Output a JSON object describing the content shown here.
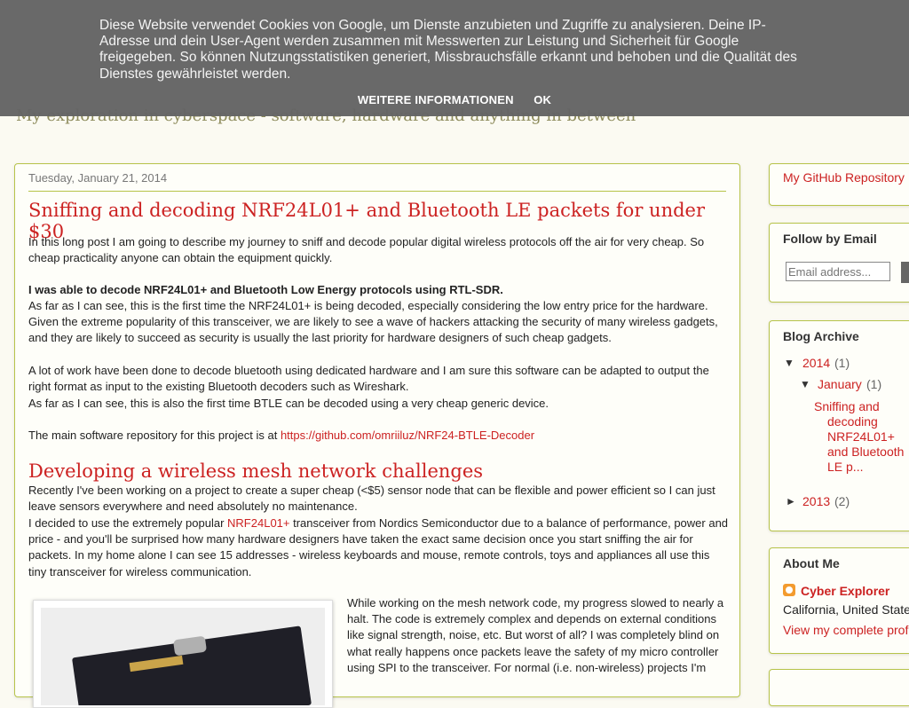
{
  "header": {
    "description": "My exploration in cyberspace - software, hardware and anything in between"
  },
  "cookie_bar": {
    "text": "Diese Website verwendet Cookies von Google, um Dienste anzubieten und Zugriffe zu analysieren. Deine IP-Adresse und dein User-Agent werden zusammen mit Messwerten zur Leistung und Sicherheit für Google freigegeben. So können Nutzungsstatistiken generiert, Missbrauchsfälle erkannt und behoben und die Qualität des Dienstes gewährleistet werden.",
    "more_info": "WEITERE INFORMATIONEN",
    "ok": "OK"
  },
  "post": {
    "date": "Tuesday, January 21, 2014",
    "title": "Sniffing and decoding NRF24L01+ and Bluetooth LE packets for under $30",
    "intro": "In this long post I am going to describe my journey to sniff and decode popular digital wireless protocols off the air for very cheap. So cheap practicality anyone can obtain the equipment quickly.",
    "bold_line": "I was able to decode NRF24L01+ and Bluetooth Low Energy protocols using RTL-SDR.",
    "para2": "As far as I can see, this is the first time the NRF24L01+ is being decoded, especially considering the low entry price for the hardware. Given the extreme popularity of this transceiver, we are likely to see a wave of hackers attacking the security of many wireless gadgets, and they are likely to succeed as security is usually the last priority for hardware designers of such cheap gadgets.",
    "para3": "A lot of work have been done to decode bluetooth using dedicated hardware and I am sure this software can be adapted to output the right format as input to the existing Bluetooth decoders such as Wireshark.",
    "para4": "As far as I can see, this is also the first time BTLE can be decoded using a very cheap generic device.",
    "repo_prefix": "The main software repository for this project is at ",
    "repo_link": "https://github.com/omriiluz/NRF24-BTLE-Decoder",
    "subheading": "Developing a wireless mesh network challenges",
    "para5": "Recently I've been working on a project to create a super cheap (<$5) sensor node that can be flexible and power efficient so I can just leave sensors everywhere and need absolutely no maintenance.",
    "para6_prefix": "I decided to use the extremely popular ",
    "para6_link": "NRF24L01+",
    "para6_suffix": " transceiver from Nordics Semiconductor due to a balance of performance, power and price - and you'll be surprised how many hardware designers have taken the exact same decision once you start sniffing the air for packets. In my home alone I can see 15 addresses - wireless keyboards and mouse, remote controls, toys and appliances all use this tiny transceiver for wireless communication.",
    "float_text": "While working on the mesh network code, my progress slowed to nearly a halt. The code is extremely complex and depends on external conditions like signal strength, noise, etc. But worst of all? I was completely blind on what really happens once packets leave the safety of my micro controller using SPI to the transceiver. For normal (i.e. non-wireless) projects I'm"
  },
  "sidebar": {
    "github_link": "My GitHub Repository",
    "follow": {
      "title": "Follow by Email",
      "placeholder": "Email address..."
    },
    "archive": {
      "title": "Blog Archive",
      "y2014": "2014",
      "y2014_count": "(1)",
      "january": "January",
      "january_count": "(1)",
      "post_lines": [
        "Sniffing and",
        "decoding",
        "NRF24L01+",
        "and Bluetooth",
        "LE p..."
      ],
      "y2013": "2013",
      "y2013_count": "(2)",
      "expanded_glyph": "▼",
      "collapsed_glyph": "►"
    },
    "about": {
      "title": "About Me",
      "name": "Cyber Explorer",
      "location": "California, United States",
      "profile_link": "View my complete profile"
    }
  }
}
